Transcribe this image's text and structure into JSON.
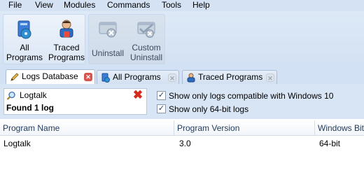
{
  "menubar": {
    "items": [
      "File",
      "View",
      "Modules",
      "Commands",
      "Tools",
      "Help"
    ]
  },
  "ribbon": {
    "buttons": [
      {
        "line1": "All",
        "line2": "Programs",
        "enabled": true,
        "icon": "all-programs-icon"
      },
      {
        "line1": "Traced",
        "line2": "Programs",
        "enabled": true,
        "icon": "traced-programs-icon"
      },
      {
        "line1": "Uninstall",
        "line2": "",
        "enabled": false,
        "icon": "uninstall-icon"
      },
      {
        "line1": "Custom",
        "line2": "Uninstall",
        "enabled": false,
        "icon": "custom-uninstall-icon"
      }
    ]
  },
  "tabs": [
    {
      "label": "Logs Database",
      "active": true,
      "icon": "database-icon"
    },
    {
      "label": "All Programs",
      "active": false,
      "icon": "programs-icon"
    },
    {
      "label": "Traced Programs",
      "active": false,
      "icon": "traced-icon"
    }
  ],
  "search": {
    "value": "Logtalk",
    "found_text": "Found 1 log",
    "clear_symbol": "✖"
  },
  "options": [
    {
      "label": "Show only logs compatible with Windows 10",
      "checked": true
    },
    {
      "label": "Show only 64-bit logs",
      "checked": true
    }
  ],
  "table": {
    "columns": [
      "Program Name",
      "Program Version",
      "Windows Bitness"
    ],
    "rows": [
      [
        "Logtalk",
        "3.0",
        "64-bit"
      ]
    ]
  },
  "colors": {
    "accent": "#2b5797",
    "close_red": "#d9534f"
  }
}
